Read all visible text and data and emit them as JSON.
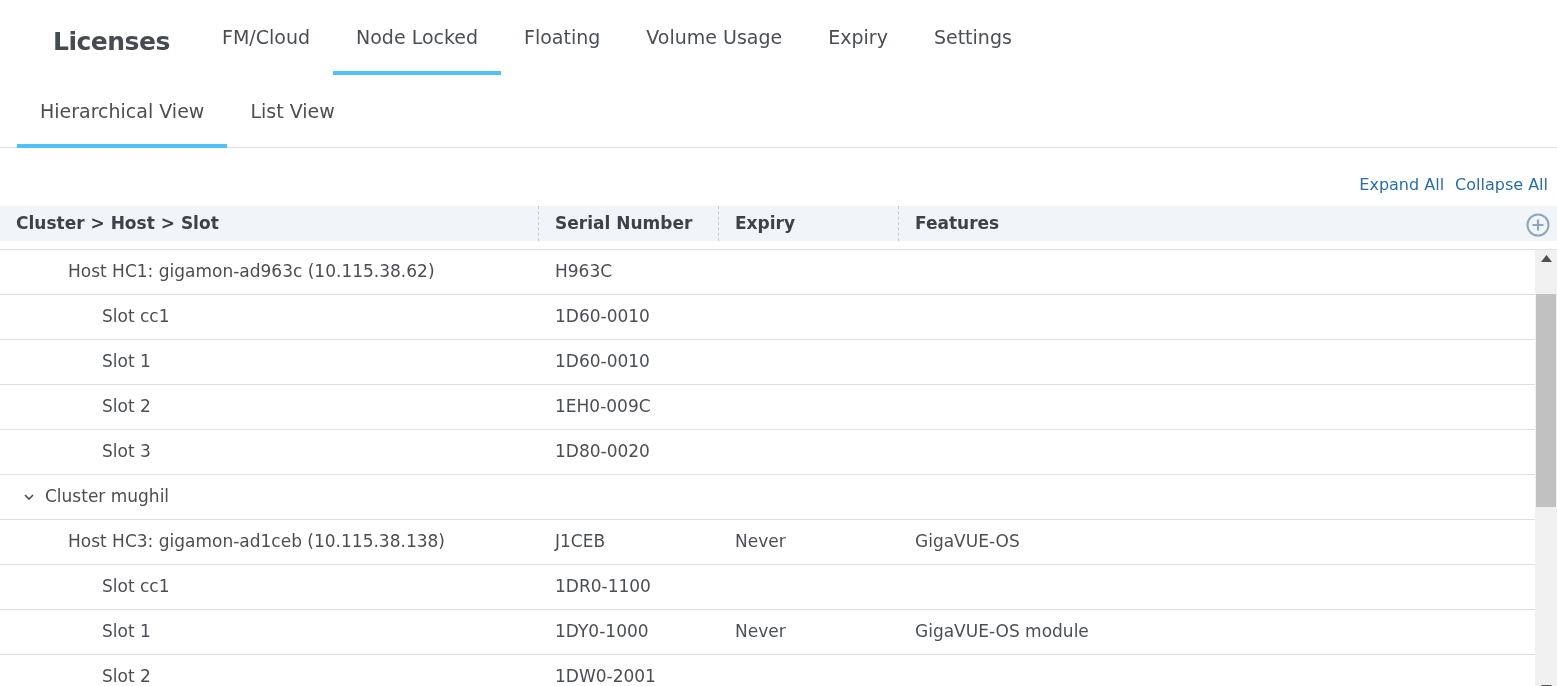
{
  "app_title": "Licenses",
  "tabs": [
    {
      "label": "FM/Cloud",
      "selected": false
    },
    {
      "label": "Node Locked",
      "selected": true
    },
    {
      "label": "Floating",
      "selected": false
    },
    {
      "label": "Volume Usage",
      "selected": false
    },
    {
      "label": "Expiry",
      "selected": false
    },
    {
      "label": "Settings",
      "selected": false
    }
  ],
  "view_tabs": [
    {
      "label": "Hierarchical View",
      "selected": true
    },
    {
      "label": "List View",
      "selected": false
    }
  ],
  "actions": [
    "Expand All",
    "Collapse All"
  ],
  "table": {
    "columns": [
      "Cluster > Host > Slot",
      "Serial Number",
      "Expiry",
      "Features"
    ],
    "rows": [
      {
        "kind": "host",
        "name": "Host HC1: gigamon-ad963c (10.115.38.62)",
        "serial": "H963C",
        "children": [
          {
            "kind": "slot",
            "name": "Slot cc1",
            "serial": "1D60-0010"
          },
          {
            "kind": "slot",
            "name": "Slot 1",
            "serial": "1D60-0010"
          },
          {
            "kind": "slot",
            "name": "Slot 2",
            "serial": "1EH0-009C"
          },
          {
            "kind": "slot",
            "name": "Slot 3",
            "serial": "1D80-0020"
          }
        ]
      },
      {
        "kind": "cluster",
        "name": "Cluster mughil",
        "expanded": true,
        "children": [
          {
            "kind": "host",
            "name": "Host HC3: gigamon-ad1ceb (10.115.38.138)",
            "serial": "J1CEB",
            "expiry": "Never",
            "features": "GigaVUE-OS",
            "children": [
              {
                "kind": "slot",
                "name": "Slot cc1",
                "serial": "1DR0-1100"
              },
              {
                "kind": "slot",
                "name": "Slot 1",
                "serial": "1DY0-1000",
                "expiry": "Never",
                "features": "GigaVUE-OS module"
              },
              {
                "kind": "slot",
                "name": "Slot 2",
                "serial": "1DW0-2001"
              }
            ]
          }
        ]
      }
    ]
  }
}
